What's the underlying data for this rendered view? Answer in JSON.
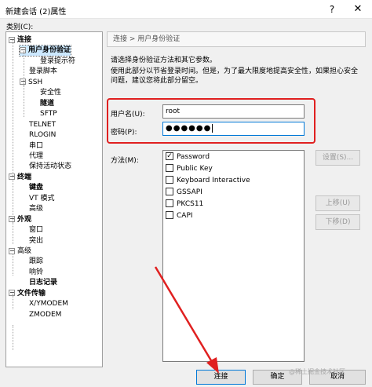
{
  "window": {
    "title": "新建会话 (2)属性",
    "help_glyph": "?",
    "close_glyph": "✕"
  },
  "category_label": "类别(C):",
  "tree": [
    {
      "label": "连接",
      "toggle": "−",
      "bold": true
    },
    {
      "label": "用户身份验证",
      "toggle": "−",
      "bold": true,
      "selected": true
    },
    {
      "label": "登录提示符"
    },
    {
      "label": "登录脚本"
    },
    {
      "label": "SSH",
      "toggle": "−"
    },
    {
      "label": "安全性"
    },
    {
      "label": "隧道",
      "bold": true
    },
    {
      "label": "SFTP"
    },
    {
      "label": "TELNET"
    },
    {
      "label": "RLOGIN"
    },
    {
      "label": "串口"
    },
    {
      "label": "代理"
    },
    {
      "label": "保持活动状态"
    },
    {
      "label": "终端",
      "toggle": "−",
      "bold": true
    },
    {
      "label": "键盘",
      "bold": true
    },
    {
      "label": "VT 模式"
    },
    {
      "label": "高级"
    },
    {
      "label": "外观",
      "toggle": "−",
      "bold": true
    },
    {
      "label": "窗口"
    },
    {
      "label": "突出"
    },
    {
      "label": "高级",
      "toggle": "−"
    },
    {
      "label": "跟踪"
    },
    {
      "label": "响铃"
    },
    {
      "label": "日志记录",
      "bold": true
    },
    {
      "label": "文件传输",
      "toggle": "−",
      "bold": true
    },
    {
      "label": "X/YMODEM"
    },
    {
      "label": "ZMODEM"
    }
  ],
  "breadcrumb": "连接 > 用户身份验证",
  "intro": "请选择身份验证方法和其它参数。",
  "description": "使用此部分以节省登录时间。但是，为了最大限度地提高安全性，如果担心安全问题，建议您将此部分留空。",
  "credentials": {
    "username_label": "用户名(U):",
    "username_value": "root",
    "password_label": "密码(P):",
    "password_value": "●●●●●●"
  },
  "methods": {
    "label": "方法(M):",
    "items": [
      {
        "label": "Password",
        "checked": true
      },
      {
        "label": "Public Key",
        "checked": false
      },
      {
        "label": "Keyboard Interactive",
        "checked": false
      },
      {
        "label": "GSSAPI",
        "checked": false
      },
      {
        "label": "PKCS11",
        "checked": false
      },
      {
        "label": "CAPI",
        "checked": false
      }
    ],
    "check_glyph": "✓"
  },
  "side_buttons": {
    "settings": "设置(S)...",
    "move_up": "上移(U)",
    "move_down": "下移(D)"
  },
  "bottom_buttons": {
    "connect": "连接",
    "ok": "确定",
    "cancel": "取消"
  },
  "watermark": "@稀土掘金技术社区",
  "colors": {
    "highlight_red": "#e02020",
    "focus_blue": "#0078d7",
    "selection_bg": "#cce8ff"
  }
}
